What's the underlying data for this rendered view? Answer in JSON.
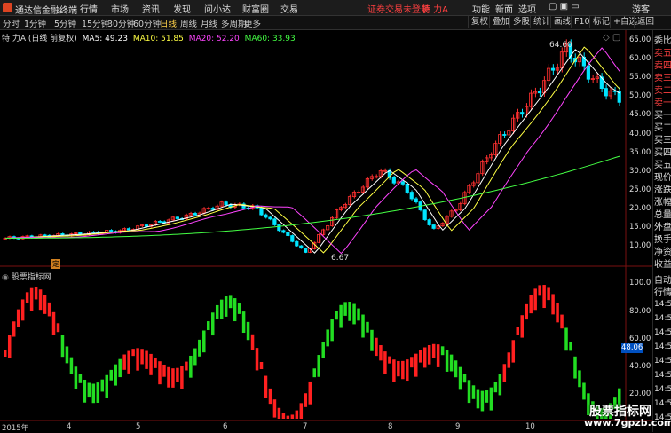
{
  "menubar": {
    "app_name": "通达信金融终端",
    "menu": [
      "行情",
      "市场",
      "资讯",
      "发现",
      "问小达",
      "财富圈",
      "交易"
    ],
    "warning": "证券交易未登录",
    "stock_name": "特 力A",
    "right": [
      "功能",
      "新面",
      "选项"
    ],
    "guest": "游客"
  },
  "periodbar": {
    "periods": [
      "分时",
      "1分钟",
      "5分钟",
      "15分钟",
      "30分钟",
      "60分钟",
      "日线",
      "周线",
      "月线",
      "多周期",
      "更多"
    ],
    "active_period": "日线",
    "tools": [
      "复权",
      "叠加",
      "多股",
      "统计",
      "画线",
      "F10",
      "标记",
      "+自选",
      "返回"
    ]
  },
  "legend": {
    "title": "特 力A (日线 前复权)",
    "ma5": "MA5: 49.23",
    "ma10": "MA10: 51.85",
    "ma20": "MA20: 52.20",
    "ma60": "MA60: 33.93",
    "colors": {
      "ma5": "#ffffff",
      "ma10": "#ffff44",
      "ma20": "#ff44ff",
      "ma60": "#44ff44"
    }
  },
  "price_axis": [
    "65.00",
    "60.00",
    "55.00",
    "50.00",
    "45.00",
    "40.00",
    "35.00",
    "30.00",
    "25.00",
    "20.00",
    "15.00",
    "10.00"
  ],
  "annotations": {
    "high": "64.60",
    "low": "6.67",
    "badge": "定"
  },
  "indicator": {
    "title": "股票指标网",
    "axis": [
      "100.0",
      "80.00",
      "60.00",
      "40.00",
      "20.00"
    ],
    "current": "48.06"
  },
  "x_axis": [
    "2015年",
    "4",
    "5",
    "6",
    "7",
    "8",
    "9",
    "10"
  ],
  "right_panel": {
    "items": [
      "委比",
      "卖五",
      "卖四",
      "卖三",
      "卖二",
      "卖一",
      "买一",
      "买二",
      "买三",
      "买四",
      "买五",
      "现价",
      "涨跌",
      "涨幅",
      "总量",
      "外盘",
      "换手",
      "净资",
      "收益"
    ],
    "auto": "自动",
    "quote": "行情",
    "times": [
      "14:50",
      "14:50",
      "14:50",
      "14:50",
      "14:50",
      "14:50",
      "14:50",
      "14:50",
      "14:50"
    ]
  },
  "watermark": {
    "line1": "股票指标网",
    "line2": "www.7gpzb.com"
  },
  "colors": {
    "up": "#ff3030",
    "down": "#00e5ff",
    "ind_up": "#ff2020",
    "ind_down": "#22dd22",
    "bg": "#000000"
  }
}
